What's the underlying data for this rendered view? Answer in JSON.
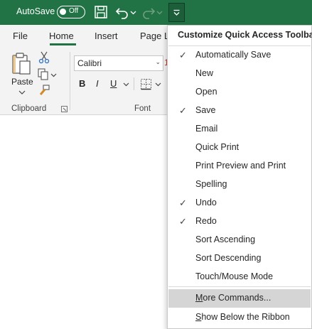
{
  "titlebar": {
    "autosave_label": "AutoSave",
    "autosave_state": "Off",
    "colors": {
      "bar": "#217346"
    }
  },
  "tabs": [
    {
      "label": "File"
    },
    {
      "label": "Home",
      "active": true
    },
    {
      "label": "Insert"
    },
    {
      "label": "Page L"
    }
  ],
  "ribbon": {
    "clipboard": {
      "group_label": "Clipboard",
      "paste_label": "Paste"
    },
    "font": {
      "group_label": "Font",
      "font_name": "Calibri",
      "bold": "B",
      "italic": "I",
      "underline": "U"
    }
  },
  "menu": {
    "title": "Customize Quick Access Toolbar",
    "items": [
      {
        "label": "Automatically Save",
        "checked": true
      },
      {
        "label": "New",
        "checked": false
      },
      {
        "label": "Open",
        "checked": false
      },
      {
        "label": "Save",
        "checked": true
      },
      {
        "label": "Email",
        "checked": false
      },
      {
        "label": "Quick Print",
        "checked": false
      },
      {
        "label": "Print Preview and Print",
        "checked": false
      },
      {
        "label": "Spelling",
        "checked": false
      },
      {
        "label": "Undo",
        "checked": true
      },
      {
        "label": "Redo",
        "checked": true
      },
      {
        "label": "Sort Ascending",
        "checked": false
      },
      {
        "label": "Sort Descending",
        "checked": false
      },
      {
        "label": "Touch/Mouse Mode",
        "checked": false
      },
      {
        "label": "More Commands...",
        "checked": false,
        "highlighted": true
      },
      {
        "label": "Show Below the Ribbon",
        "checked": false
      }
    ],
    "check_glyph": "✓"
  }
}
